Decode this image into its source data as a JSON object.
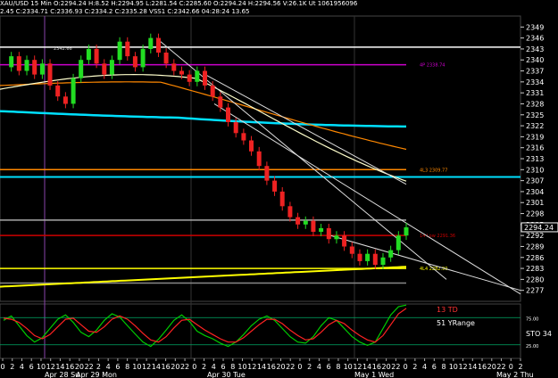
{
  "header": {
    "line1": "XAU/USD 15 Min  O:2294.24 H:8.52 H:2294.95 L:2281.54 C:2285.60 O:2294.24 H:2294.56 V:26.1K Ut 1061956096",
    "line2": "2.45 C:2334.71 C:2336.93 C:2334.2 C:2335.28 VSS1 C:2342.66 04:28:24 13.65"
  },
  "chart_data": [
    {
      "type": "candlestick",
      "symbol": "XAU/USD",
      "interval": "15 Min",
      "ylim": [
        2274,
        2352
      ],
      "y_ticks": [
        2349,
        2346,
        2343,
        2340,
        2337,
        2334,
        2331,
        2328,
        2325,
        2322,
        2319,
        2316,
        2313,
        2310,
        2307,
        2304,
        2301,
        2298,
        2295,
        2292,
        2289,
        2286,
        2283,
        2280,
        2277
      ],
      "current_price": "2294.24",
      "x_tick_labels": [
        "0",
        "2",
        "4",
        "6",
        "10",
        "12",
        "14",
        "16",
        "20",
        "22",
        "2",
        "4",
        "6",
        "8",
        "10",
        "12",
        "14",
        "16",
        "20",
        "22",
        "0",
        "2",
        "4",
        "6",
        "8",
        "10",
        "12",
        "14",
        "16",
        "20",
        "22",
        "0",
        "2",
        "4",
        "6",
        "8",
        "10",
        "12",
        "14",
        "16",
        "20",
        "22",
        "0",
        "2",
        "4",
        "6",
        "8",
        "10",
        "12",
        "14",
        "16",
        "20",
        "22",
        "0",
        "2"
      ],
      "session_labels": [
        "Apr 28 Su",
        "Apr 29 Mon",
        "Apr 30 Tue",
        "May 1 Wed",
        "May 2 Thu"
      ],
      "price_path": [
        2338,
        2341,
        2337,
        2340,
        2336,
        2339,
        2333,
        2330,
        2328,
        2335,
        2340,
        2343,
        2339,
        2336,
        2340,
        2345,
        2341,
        2338,
        2343,
        2346,
        2342,
        2339,
        2337,
        2336,
        2334,
        2337,
        2333,
        2330,
        2327,
        2323,
        2320,
        2318,
        2315,
        2311,
        2307,
        2304,
        2300,
        2297,
        2295,
        2296,
        2293,
        2294,
        2291,
        2292,
        2289,
        2287,
        2285,
        2287,
        2284,
        2286,
        2288,
        2292,
        2294.24
      ],
      "horizontal_levels": [
        {
          "price": 2343.5,
          "color": "#ffffff"
        },
        {
          "price": 2338.7,
          "color": "#cc00cc",
          "label": "4P 2338.74"
        },
        {
          "price": 2310.0,
          "color": "#ff8800",
          "label": "4L3 2309.77"
        },
        {
          "price": 2308.0,
          "color": "#00e0ff"
        },
        {
          "price": 2296.2,
          "color": "#aaaaaa"
        },
        {
          "price": 2292.0,
          "color": "#cc0000",
          "label": "14 Low 2291.36"
        },
        {
          "price": 2283.0,
          "color": "#ffff00",
          "label": "4L4 2282.90"
        },
        {
          "price": 2279.0,
          "color": "#888888"
        }
      ],
      "annotations": [
        {
          "text": "2342.66"
        }
      ],
      "moving_averages": [
        {
          "name": "",
          "color": "#00e0ff"
        },
        {
          "name": "",
          "color": "#ff8800"
        },
        {
          "name": "",
          "color": "#ffffcc"
        },
        {
          "name": "",
          "color": "#ffff00"
        }
      ],
      "grid": false
    },
    {
      "type": "line",
      "indicator": "STO",
      "value_label": "STO  34",
      "levels": [
        75,
        25
      ],
      "level_labels": [
        "75.00",
        "25.00"
      ],
      "text_labels": [
        "13 TD",
        "51 YRange"
      ],
      "series": [
        {
          "name": "",
          "color": "#00cc00",
          "values": [
            70,
            78,
            60,
            42,
            30,
            38,
            55,
            72,
            80,
            66,
            48,
            40,
            52,
            70,
            82,
            76,
            60,
            45,
            30,
            22,
            35,
            52,
            70,
            80,
            68,
            50,
            42,
            36,
            28,
            22,
            30,
            44,
            60,
            72,
            78,
            70,
            55,
            40,
            30,
            28,
            40,
            60,
            75,
            70,
            55,
            40,
            30,
            24,
            30,
            55,
            80,
            95,
            98
          ]
        },
        {
          "name": "",
          "color": "#ff2222",
          "values": [
            74,
            72,
            66,
            55,
            42,
            36,
            44,
            58,
            72,
            74,
            62,
            50,
            48,
            58,
            72,
            78,
            72,
            60,
            46,
            34,
            30,
            40,
            56,
            70,
            72,
            62,
            52,
            44,
            36,
            30,
            30,
            38,
            50,
            62,
            72,
            72,
            64,
            52,
            42,
            34,
            36,
            48,
            62,
            70,
            64,
            52,
            42,
            34,
            30,
            42,
            62,
            82,
            92
          ]
        }
      ]
    }
  ]
}
